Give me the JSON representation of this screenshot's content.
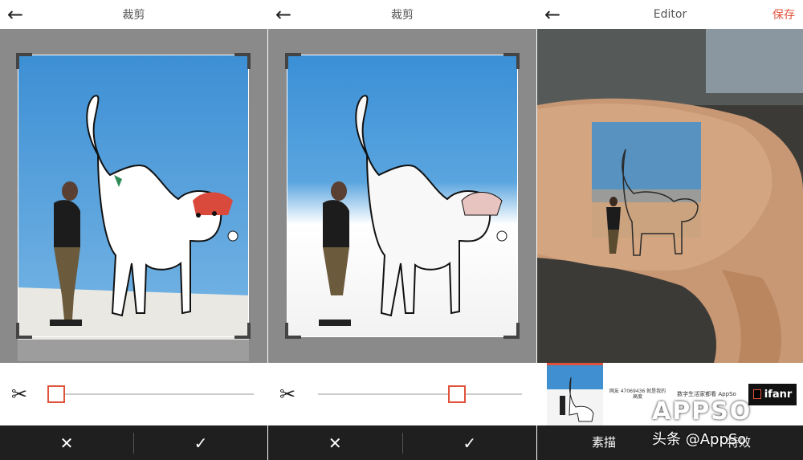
{
  "panel1": {
    "title": "裁剪",
    "actions": {
      "cancel": "✕",
      "confirm": "✓"
    },
    "slider_value": 0.04
  },
  "panel2": {
    "title": "裁剪",
    "actions": {
      "cancel": "✕",
      "confirm": "✓"
    },
    "slider_value": 0.68
  },
  "panel3": {
    "title": "Editor",
    "save_label": "保存",
    "thumbnails": [
      {
        "label": "网友 47069436 就是我的高度"
      },
      {
        "label": "数字生活家都看 AppSo"
      },
      {
        "label": "ifanr"
      }
    ],
    "tabs": [
      {
        "label": "素描"
      },
      {
        "label": "特效"
      }
    ]
  },
  "watermark": {
    "brand": "APPSO",
    "credit": "头条 @AppSo"
  },
  "colors": {
    "accent": "#e0533b",
    "sky": "#3f8fd1",
    "dark_bar": "#1f1f1f",
    "stage_gray": "#8a8a8a"
  }
}
